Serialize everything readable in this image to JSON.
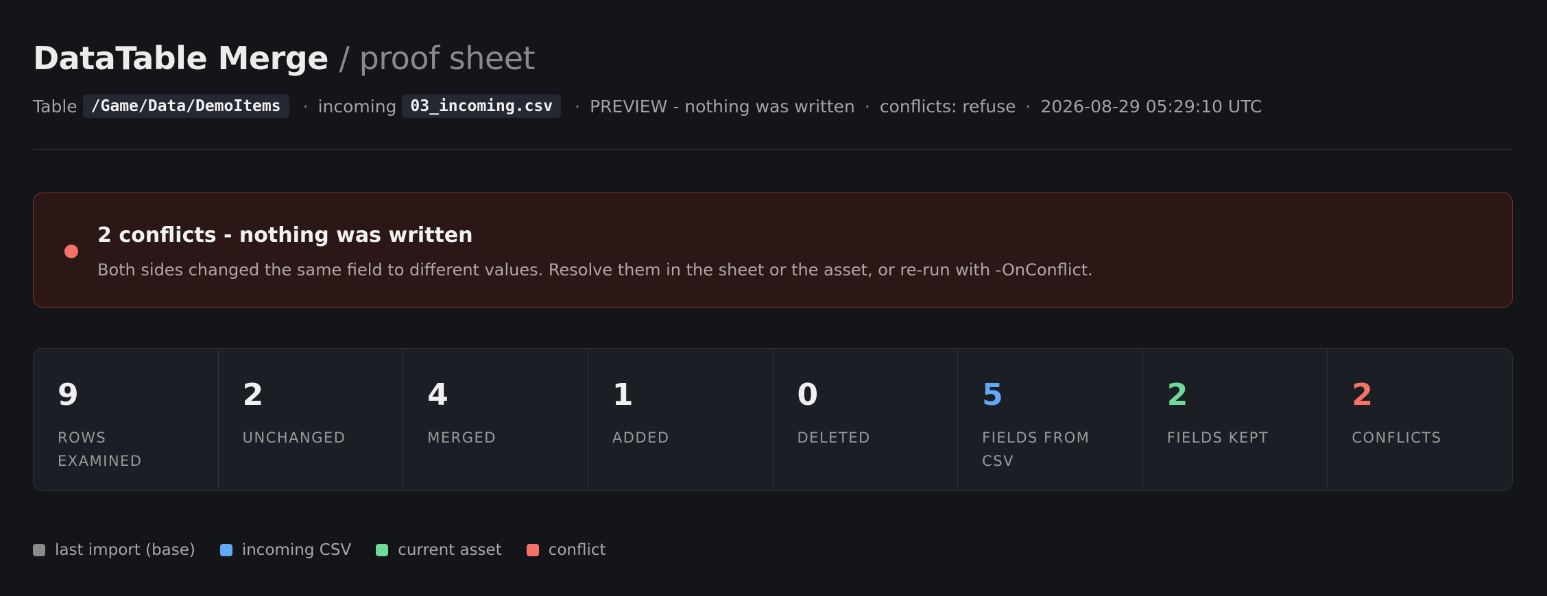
{
  "header": {
    "title": "DataTable Merge",
    "subtitle": "/ proof sheet"
  },
  "meta": {
    "table_label": "Table",
    "table_path": "/Game/Data/DemoItems",
    "incoming_label": "incoming",
    "incoming_file": "03_incoming.csv",
    "separator": "·",
    "mode": "PREVIEW - nothing was written",
    "conflicts_mode": "conflicts: refuse",
    "timestamp": "2026-08-29 05:29:10 UTC"
  },
  "alert": {
    "title": "2 conflicts - nothing was written",
    "body": "Both sides changed the same field to different values. Resolve them in the sheet or the asset, or re-run with -OnConflict.",
    "color": "#f47366"
  },
  "stats": [
    {
      "value": "9",
      "label": "ROWS EXAMINED",
      "color": "#f0f0f0"
    },
    {
      "value": "2",
      "label": "UNCHANGED",
      "color": "#f0f0f0"
    },
    {
      "value": "4",
      "label": "MERGED",
      "color": "#f0f0f0"
    },
    {
      "value": "1",
      "label": "ADDED",
      "color": "#f0f0f0"
    },
    {
      "value": "0",
      "label": "DELETED",
      "color": "#f0f0f0"
    },
    {
      "value": "5",
      "label": "FIELDS FROM CSV",
      "color": "#62a8f5"
    },
    {
      "value": "2",
      "label": "FIELDS KEPT",
      "color": "#6fd99a"
    },
    {
      "value": "2",
      "label": "CONFLICTS",
      "color": "#f47366"
    }
  ],
  "legend": [
    {
      "label": "last import (base)",
      "color": "#8a8a8a"
    },
    {
      "label": "incoming CSV",
      "color": "#62a8f5"
    },
    {
      "label": "current asset",
      "color": "#6fd99a"
    },
    {
      "label": "conflict",
      "color": "#f47366"
    }
  ]
}
